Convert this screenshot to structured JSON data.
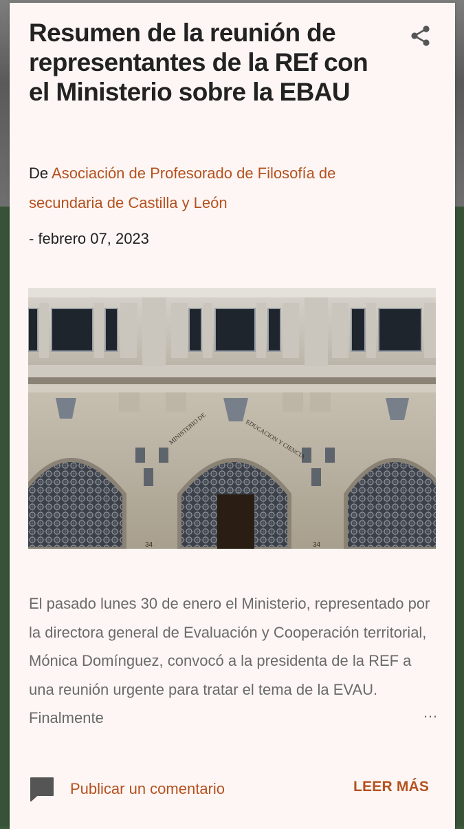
{
  "post": {
    "title": "Resumen de la reunión de representantes de la REf con el Ministerio sobre la EBAU",
    "byline_prefix": "De",
    "author": "Asociación de Profesorado de Filosofía de secundaria de Castilla y León",
    "date": "- febrero 07, 2023",
    "excerpt": "El pasado lunes 30 de enero el Ministerio, representado por la directora general de Evaluación y Cooperación territorial, Mónica Domínguez, convocó a la presidenta de la REF a una reunión urgente para tratar el tema de la EVAU. Finalmente",
    "ellipsis": "…"
  },
  "image": {
    "inscription_left": "MINISTERIO DE",
    "inscription_right": "EDUCACION Y CIENCIA",
    "number_left": "34",
    "number_right": "34"
  },
  "footer": {
    "comment_label": "Publicar un comentario",
    "read_more_label": "LEER MÁS"
  },
  "icons": {
    "share": "share-icon",
    "comment": "comment-icon"
  },
  "colors": {
    "accent": "#b5511f",
    "card_background": "#fdf6f4",
    "page_background": "#375236"
  }
}
